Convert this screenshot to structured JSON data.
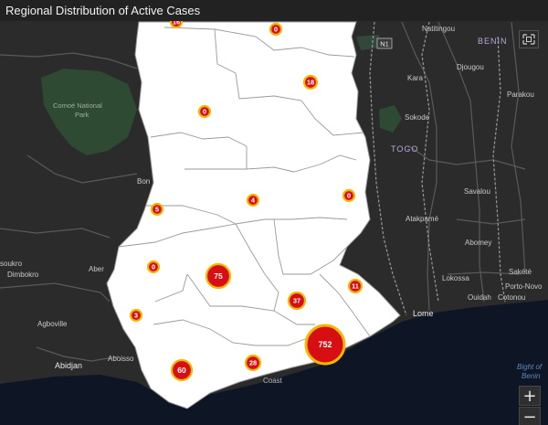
{
  "title": "Regional Distribution of Active Cases",
  "labels": {
    "benin": "BENIN",
    "togo": "TOGO",
    "park_line1": "Comoé National",
    "park_line2": "Park",
    "natitingou": "Natitingou",
    "djougou": "Djougou",
    "kara": "Kara",
    "parakou": "Parakou",
    "sokode": "Sokode",
    "savalou": "Savalou",
    "atakpame": "Atakpamé",
    "abomey": "Abomey",
    "lokossa": "Lokossa",
    "sakete": "Sakété",
    "porto_novo": "Porto-Novo",
    "ouidah": "Ouidah",
    "cotonou": "Cotonou",
    "lome": "Lome",
    "bight_line1": "Bight of",
    "bight_line2": "Benin",
    "abidjan": "Abidjan",
    "aboisso": "Aboisso",
    "agboville": "Agboville",
    "dimbokro": "Dimbokro",
    "soukro": "soukro",
    "bon": "Bon",
    "aber": "Aber",
    "coast": "Coast"
  },
  "markers": [
    {
      "value": "16"
    },
    {
      "value": "0"
    },
    {
      "value": "18"
    },
    {
      "value": "0"
    },
    {
      "value": "4"
    },
    {
      "value": "0"
    },
    {
      "value": "5"
    },
    {
      "value": "0"
    },
    {
      "value": "75"
    },
    {
      "value": "37"
    },
    {
      "value": "11"
    },
    {
      "value": "3"
    },
    {
      "value": "752"
    },
    {
      "value": "60"
    },
    {
      "value": "28"
    }
  ],
  "controls": {
    "zoom_in": "+",
    "zoom_out": "−"
  },
  "colors": {
    "marker_fill": "#d80f12",
    "marker_ring": "#f2b705",
    "land_dark": "#2b2b2b",
    "ghana_fill": "#ffffff",
    "water": "#0e1626"
  }
}
